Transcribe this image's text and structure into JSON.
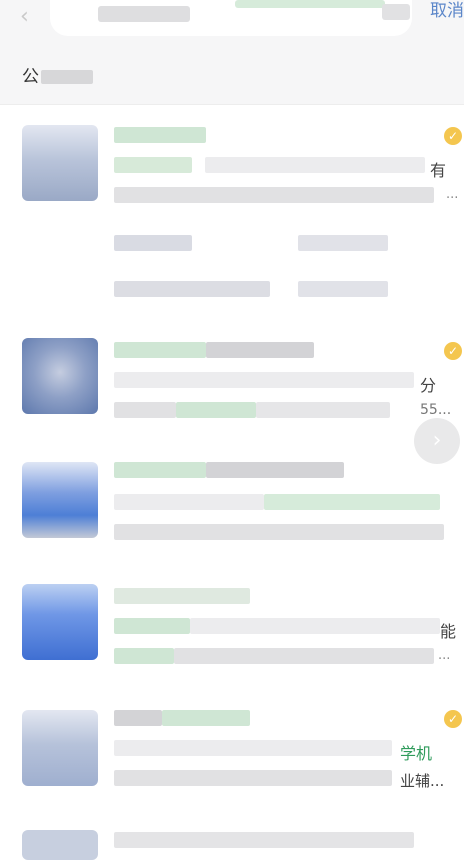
{
  "header": {
    "cancel_label": "取消"
  },
  "section": {
    "title": "公"
  },
  "results": [
    {
      "trail": "有",
      "trail2": "...",
      "verified": true
    },
    {
      "trail": "分",
      "trail2": "55...",
      "verified": true
    },
    {
      "trail": "",
      "trail2": "",
      "verified": false
    },
    {
      "trail": "能",
      "trail2": "...",
      "verified": false
    },
    {
      "trail": "学机",
      "trail2": "业辅...",
      "verified": true
    }
  ],
  "icons": {
    "back": "chevron-left-icon",
    "verified": "verified-badge-icon",
    "float": "chevron-right-icon"
  },
  "colors": {
    "accent_link": "#5b86c9",
    "verified_badge": "#f4c64f",
    "blur_green": "#cfe6d4",
    "blur_gray": "#d9d9dc",
    "avatar_blue": "#4d7fd6"
  }
}
